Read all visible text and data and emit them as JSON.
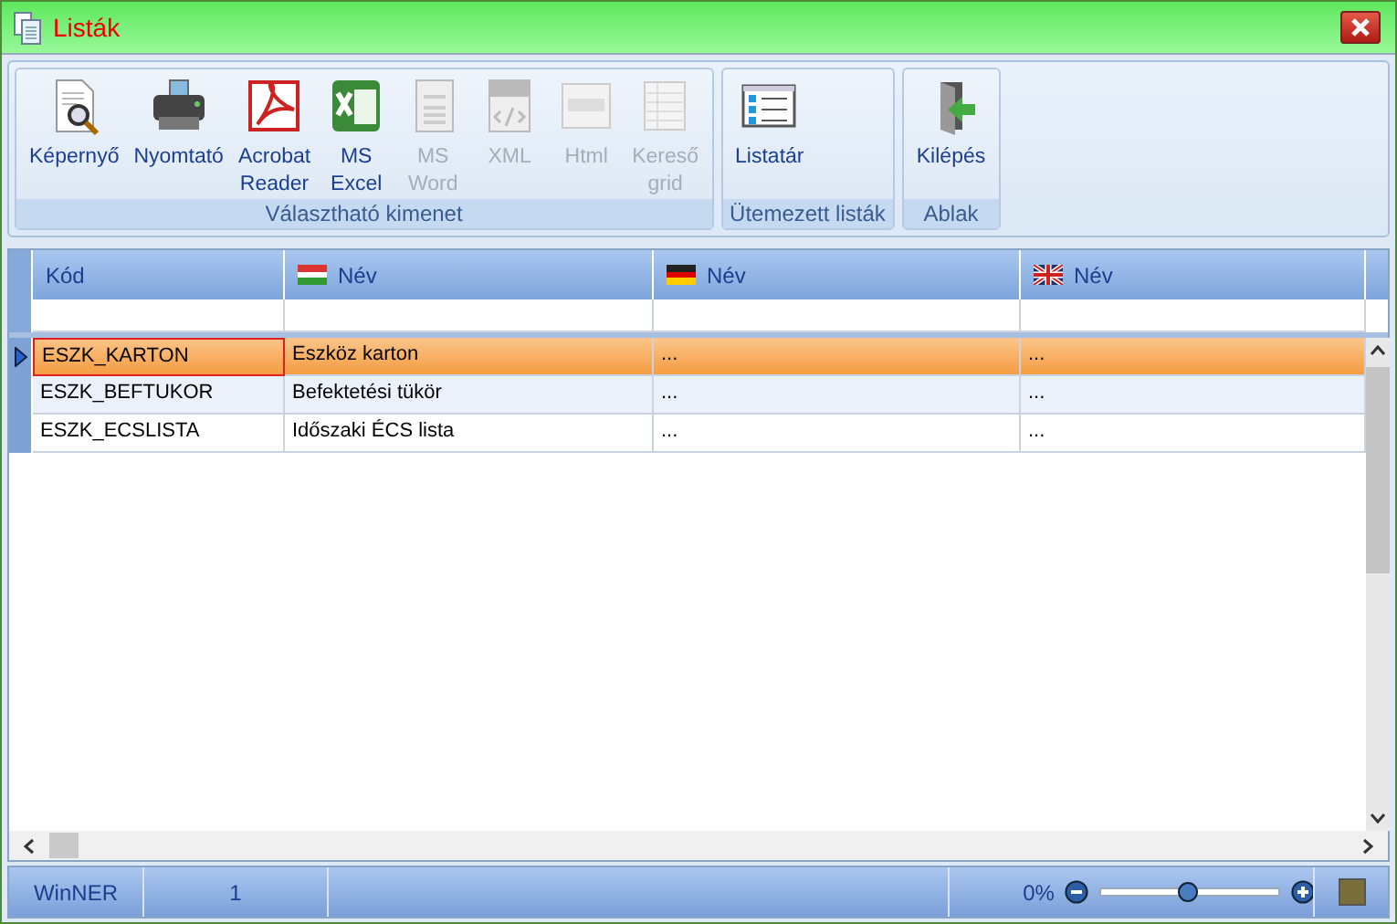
{
  "window": {
    "title": "Listák"
  },
  "ribbon": {
    "groups": [
      {
        "label": "Választható kimenet",
        "buttons": [
          {
            "label": "Képernyő",
            "disabled": false
          },
          {
            "label": "Nyomtató",
            "disabled": false
          },
          {
            "label": "Acrobat Reader",
            "disabled": false
          },
          {
            "label": "MS Excel",
            "disabled": false
          },
          {
            "label": "MS Word",
            "disabled": true
          },
          {
            "label": "XML",
            "disabled": true
          },
          {
            "label": "Html",
            "disabled": true
          },
          {
            "label": "Kereső grid",
            "disabled": true
          }
        ]
      },
      {
        "label": "Ütemezett listák",
        "buttons": [
          {
            "label": "Listatár",
            "disabled": false
          }
        ]
      },
      {
        "label": "Ablak",
        "buttons": [
          {
            "label": "Kilépés",
            "disabled": false
          }
        ]
      }
    ]
  },
  "table": {
    "columns": [
      "Kód",
      "Név",
      "Név",
      "Név"
    ],
    "rows": [
      {
        "selected": true,
        "cells": [
          "ESZK_KARTON",
          "Eszköz karton",
          "...",
          "..."
        ]
      },
      {
        "selected": false,
        "cells": [
          "ESZK_BEFTUKOR",
          "Befektetési tükör",
          "...",
          "..."
        ]
      },
      {
        "selected": false,
        "cells": [
          "ESZK_ECSLISTA",
          "Időszaki ÉCS lista",
          "...",
          "..."
        ]
      }
    ]
  },
  "status_bar": {
    "app": "WinNER",
    "count": "1",
    "zoom": "0%",
    "zoom_level": {
      "level": 0.49
    }
  }
}
